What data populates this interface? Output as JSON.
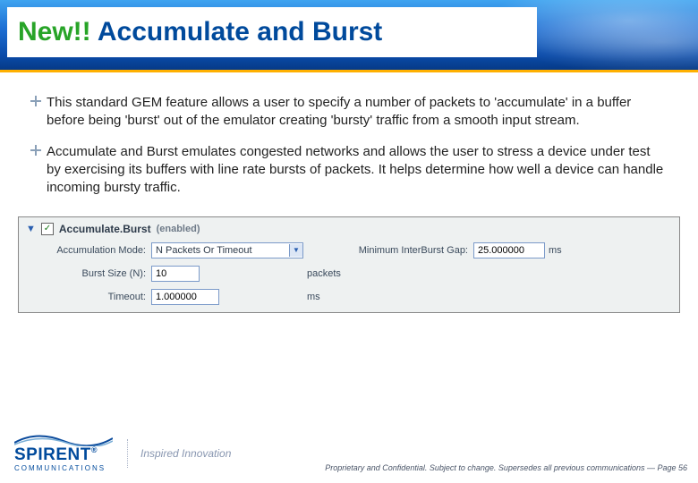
{
  "title": {
    "new": "New!!",
    "rest": " Accumulate and Burst"
  },
  "bullets": [
    "This standard GEM feature allows a user to specify a number of packets to 'accumulate' in a buffer before being 'burst' out of the emulator creating 'bursty' traffic from a smooth input stream.",
    "Accumulate and Burst emulates congested networks and allows the user to stress a device under test by exercising its buffers with line rate bursts of packets.  It helps determine how well a device can handle incoming bursty traffic."
  ],
  "panel": {
    "header_title": "Accumulate.Burst",
    "header_sub": "(enabled)",
    "checkbox_checked": true,
    "fields": {
      "mode_label": "Accumulation Mode:",
      "mode_value": "N Packets Or Timeout",
      "gap_label": "Minimum InterBurst Gap:",
      "gap_value": "25.000000",
      "gap_unit": "ms",
      "burst_label": "Burst Size (N):",
      "burst_value": "10",
      "burst_unit": "packets",
      "timeout_label": "Timeout:",
      "timeout_value": "1.000000",
      "timeout_unit": "ms"
    }
  },
  "footer": {
    "brand": "SPIRENT",
    "brand_sub": "COMMUNICATIONS",
    "tagline": "Inspired Innovation",
    "legal": "Proprietary and Confidential.  Subject to change.  Supersedes all previous communications — Page 56"
  }
}
